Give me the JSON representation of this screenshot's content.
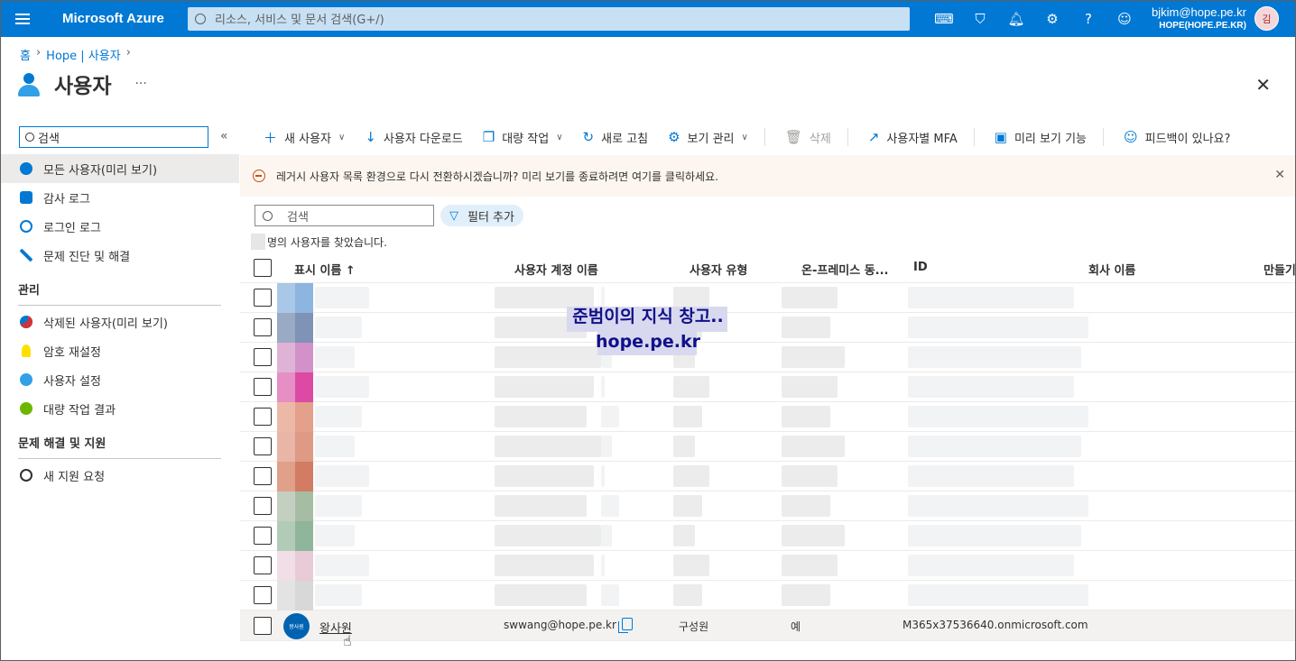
{
  "topbar": {
    "brand": "Microsoft Azure",
    "search_placeholder": "리소스, 서비스 및 문서 검색(G+/)",
    "icons": [
      "cloud-shell-icon",
      "directory-filter-icon",
      "bell-icon",
      "gear-icon",
      "help-icon",
      "feedback-icon"
    ],
    "account_email": "bjkim@hope.pe.kr",
    "account_tenant": "HOPE(HOPE.PE.KR)",
    "avatar_initial": "김",
    "color": "#0078d4"
  },
  "breadcrumb": [
    "홈",
    "Hope | 사용자"
  ],
  "page": {
    "title": "사용자",
    "more": "···"
  },
  "sidebar": {
    "search_value": "검색",
    "items": [
      {
        "label": "모든 사용자(미리 보기)",
        "icon": "users-icon",
        "active": true
      },
      {
        "label": "감사 로그",
        "icon": "audit-log-icon"
      },
      {
        "label": "로그인 로그",
        "icon": "signin-log-icon"
      },
      {
        "label": "문제 진단 및 해결",
        "icon": "troubleshoot-icon"
      }
    ],
    "section_manage": "관리",
    "manage_items": [
      {
        "label": "삭제된 사용자(미리 보기)",
        "icon": "deleted-user-icon"
      },
      {
        "label": "암호 재설정",
        "icon": "key-icon"
      },
      {
        "label": "사용자 설정",
        "icon": "user-settings-icon"
      },
      {
        "label": "대량 작업 결과",
        "icon": "bulk-results-icon"
      }
    ],
    "section_support": "문제 해결 및 지원",
    "support_items": [
      {
        "label": "새 지원 요청",
        "icon": "support-request-icon"
      }
    ]
  },
  "toolbar": {
    "new_user": "새 사용자",
    "download": "사용자 다운로드",
    "bulk": "대량 작업",
    "refresh": "새로 고침",
    "manage_view": "보기 관리",
    "delete": "삭제",
    "per_user_mfa": "사용자별 MFA",
    "preview_features": "미리 보기 기능",
    "feedback": "피드백이 있나요?"
  },
  "banner": {
    "text": "레거시 사용자 목록 환경으로 다시 전환하시겠습니까? 미리 보기를 종료하려면 여기를 클릭하세요."
  },
  "list": {
    "search_placeholder": "검색",
    "filter_label": "필터 추가",
    "found_text": "명의 사용자를 찾았습니다."
  },
  "table": {
    "columns": [
      "표시 이름 ↑",
      "사용자 계정 이름",
      "사용자 유형",
      "온-프레미스 동...",
      "ID",
      "회사 이름",
      "만들기"
    ],
    "blurred_row_colors": [
      [
        "#a9c8e8",
        "#8eb5e0"
      ],
      [
        "#9aa9c4",
        "#7f93b6"
      ],
      [
        "#dfb3d6",
        "#d291c8"
      ],
      [
        "#e68fc4",
        "#dd4aa3"
      ],
      [
        "#ecb9a8",
        "#e3a08a"
      ],
      [
        "#e8b5a6",
        "#de9a85"
      ],
      [
        "#e0a08a",
        "#d27c63"
      ],
      [
        "#c3cfc0",
        "#a6bda3"
      ],
      [
        "#b2cbb8",
        "#8fb59a"
      ],
      [
        "#f2dee6",
        "#e8cbd6"
      ],
      [
        "#e3e3e3",
        "#d8d8d8"
      ],
      [
        "#9ebfa8",
        "#6b9d7b"
      ],
      [
        "#b3d8d8",
        "#8ec8c8"
      ],
      [
        "#a3d0d2",
        "#6ab9bf"
      ],
      [
        "#e2e2e2",
        "#d2d2d2"
      ],
      [
        "#dcdcdc",
        "#c9c9c9"
      ],
      [
        "#d4c8c6",
        "#b9a9a5"
      ]
    ],
    "last_row": {
      "avatar_text": "왕사원",
      "display_name": "왕사원",
      "upn": "swwang@hope.pe.kr",
      "user_type": "구성원",
      "onprem": "예",
      "id_domain": "M365x37536640.onmicrosoft.com"
    }
  },
  "watermark": {
    "line1": "준범이의 지식 창고..",
    "line2": "hope.pe.kr"
  }
}
